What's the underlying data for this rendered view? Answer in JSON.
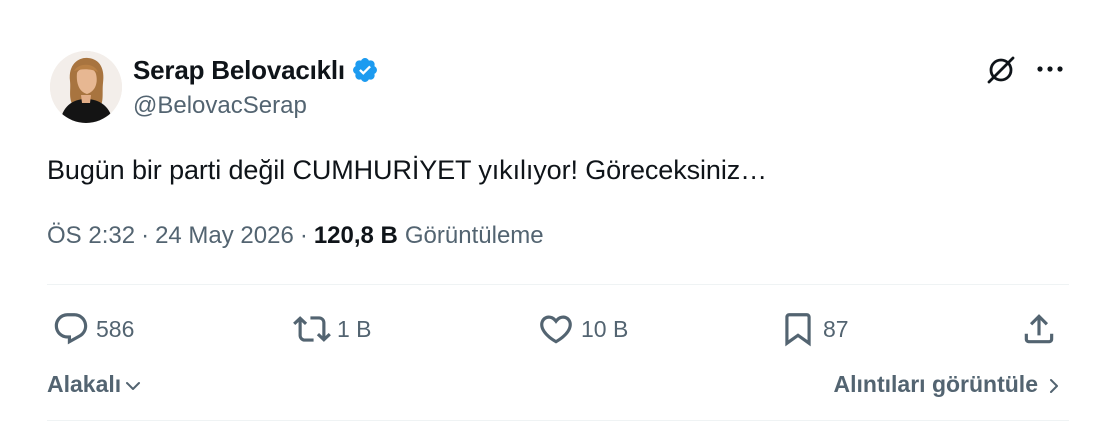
{
  "author": {
    "display_name": "Serap Belovacıklı",
    "handle": "@BelovacSerap",
    "verified_color": "#1d9bf0"
  },
  "icons": {
    "verified": "verified-badge-icon",
    "grok": "grok-icon",
    "more": "more-icon",
    "reply": "reply-icon",
    "retweet": "retweet-icon",
    "like": "like-icon",
    "bookmark": "bookmark-icon",
    "share": "share-icon"
  },
  "tweet": {
    "text": "Bugün bir parti değil CUMHURİYET yıkılıyor! Göreceksiniz…",
    "time": "ÖS 2:32",
    "separator": "·",
    "date": "24 May 2026",
    "views_count": "120,8 B",
    "views_label": "Görüntüleme"
  },
  "actions": {
    "reply_count": "586",
    "retweet_count": "1 B",
    "like_count": "10 B",
    "bookmark_count": "87"
  },
  "footer": {
    "relevance_label": "Alakalı",
    "quotes_label": "Alıntıları görüntüle"
  },
  "colors": {
    "text_primary": "#0f1419",
    "text_secondary": "#536471",
    "divider": "#eff3f4",
    "accent": "#1d9bf0"
  }
}
